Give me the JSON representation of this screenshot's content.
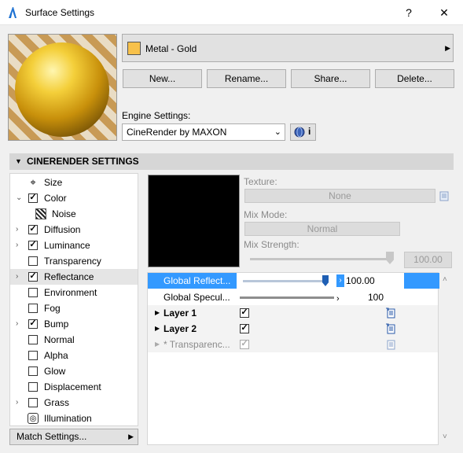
{
  "window": {
    "title": "Surface Settings",
    "help_btn": "?",
    "close_btn": "✕"
  },
  "material": {
    "name": "Metal - Gold",
    "swatch_color": "#f7c14b",
    "buttons": {
      "new": "New...",
      "rename": "Rename...",
      "share": "Share...",
      "delete": "Delete..."
    }
  },
  "engine": {
    "label": "Engine Settings:",
    "value": "CineRender by MAXON",
    "info_glyph": "i"
  },
  "section": {
    "title": "CINERENDER SETTINGS"
  },
  "channels": [
    {
      "label": "Size",
      "expander": "",
      "checkbox": "none",
      "icon": "size-icon",
      "selected": false
    },
    {
      "label": "Color",
      "expander": "expanded",
      "checkbox": "checked",
      "selected": false
    },
    {
      "label": "Noise",
      "expander": "",
      "checkbox": "none",
      "icon": "noise-icon",
      "sub": true,
      "selected": false
    },
    {
      "label": "Diffusion",
      "expander": "collapsed",
      "checkbox": "checked",
      "selected": false
    },
    {
      "label": "Luminance",
      "expander": "collapsed",
      "checkbox": "checked",
      "selected": false
    },
    {
      "label": "Transparency",
      "expander": "",
      "checkbox": "unchecked",
      "selected": false
    },
    {
      "label": "Reflectance",
      "expander": "collapsed",
      "checkbox": "checked",
      "selected": true
    },
    {
      "label": "Environment",
      "expander": "",
      "checkbox": "unchecked",
      "selected": false
    },
    {
      "label": "Fog",
      "expander": "",
      "checkbox": "unchecked",
      "selected": false
    },
    {
      "label": "Bump",
      "expander": "collapsed",
      "checkbox": "checked",
      "selected": false
    },
    {
      "label": "Normal",
      "expander": "",
      "checkbox": "unchecked",
      "selected": false
    },
    {
      "label": "Alpha",
      "expander": "",
      "checkbox": "unchecked",
      "selected": false
    },
    {
      "label": "Glow",
      "expander": "",
      "checkbox": "unchecked",
      "selected": false
    },
    {
      "label": "Displacement",
      "expander": "",
      "checkbox": "unchecked",
      "selected": false
    },
    {
      "label": "Grass",
      "expander": "collapsed",
      "checkbox": "unchecked",
      "selected": false
    },
    {
      "label": "Illumination",
      "expander": "",
      "checkbox": "none",
      "icon": "illumination-icon",
      "selected": false
    }
  ],
  "match_settings": "Match Settings...",
  "texture": {
    "label": "Texture:",
    "value": "None",
    "mix_mode_label": "Mix Mode:",
    "mix_mode_value": "Normal",
    "mix_strength_label": "Mix Strength:",
    "mix_strength_value": "100.00"
  },
  "params": [
    {
      "name": "Global Reflect...",
      "value": "100.00",
      "highlighted": true
    },
    {
      "name": "Global Specul...",
      "value": "100",
      "highlighted": false
    },
    {
      "name": "Layer 1",
      "bold": true,
      "checked": true
    },
    {
      "name": "Layer 2",
      "bold": true,
      "checked": true
    },
    {
      "name": "* Transparenc...",
      "bold": false,
      "checked": true,
      "disabled": true
    }
  ],
  "colors": {
    "accent": "#3399ff",
    "selected_row": "#e5e5e5"
  }
}
